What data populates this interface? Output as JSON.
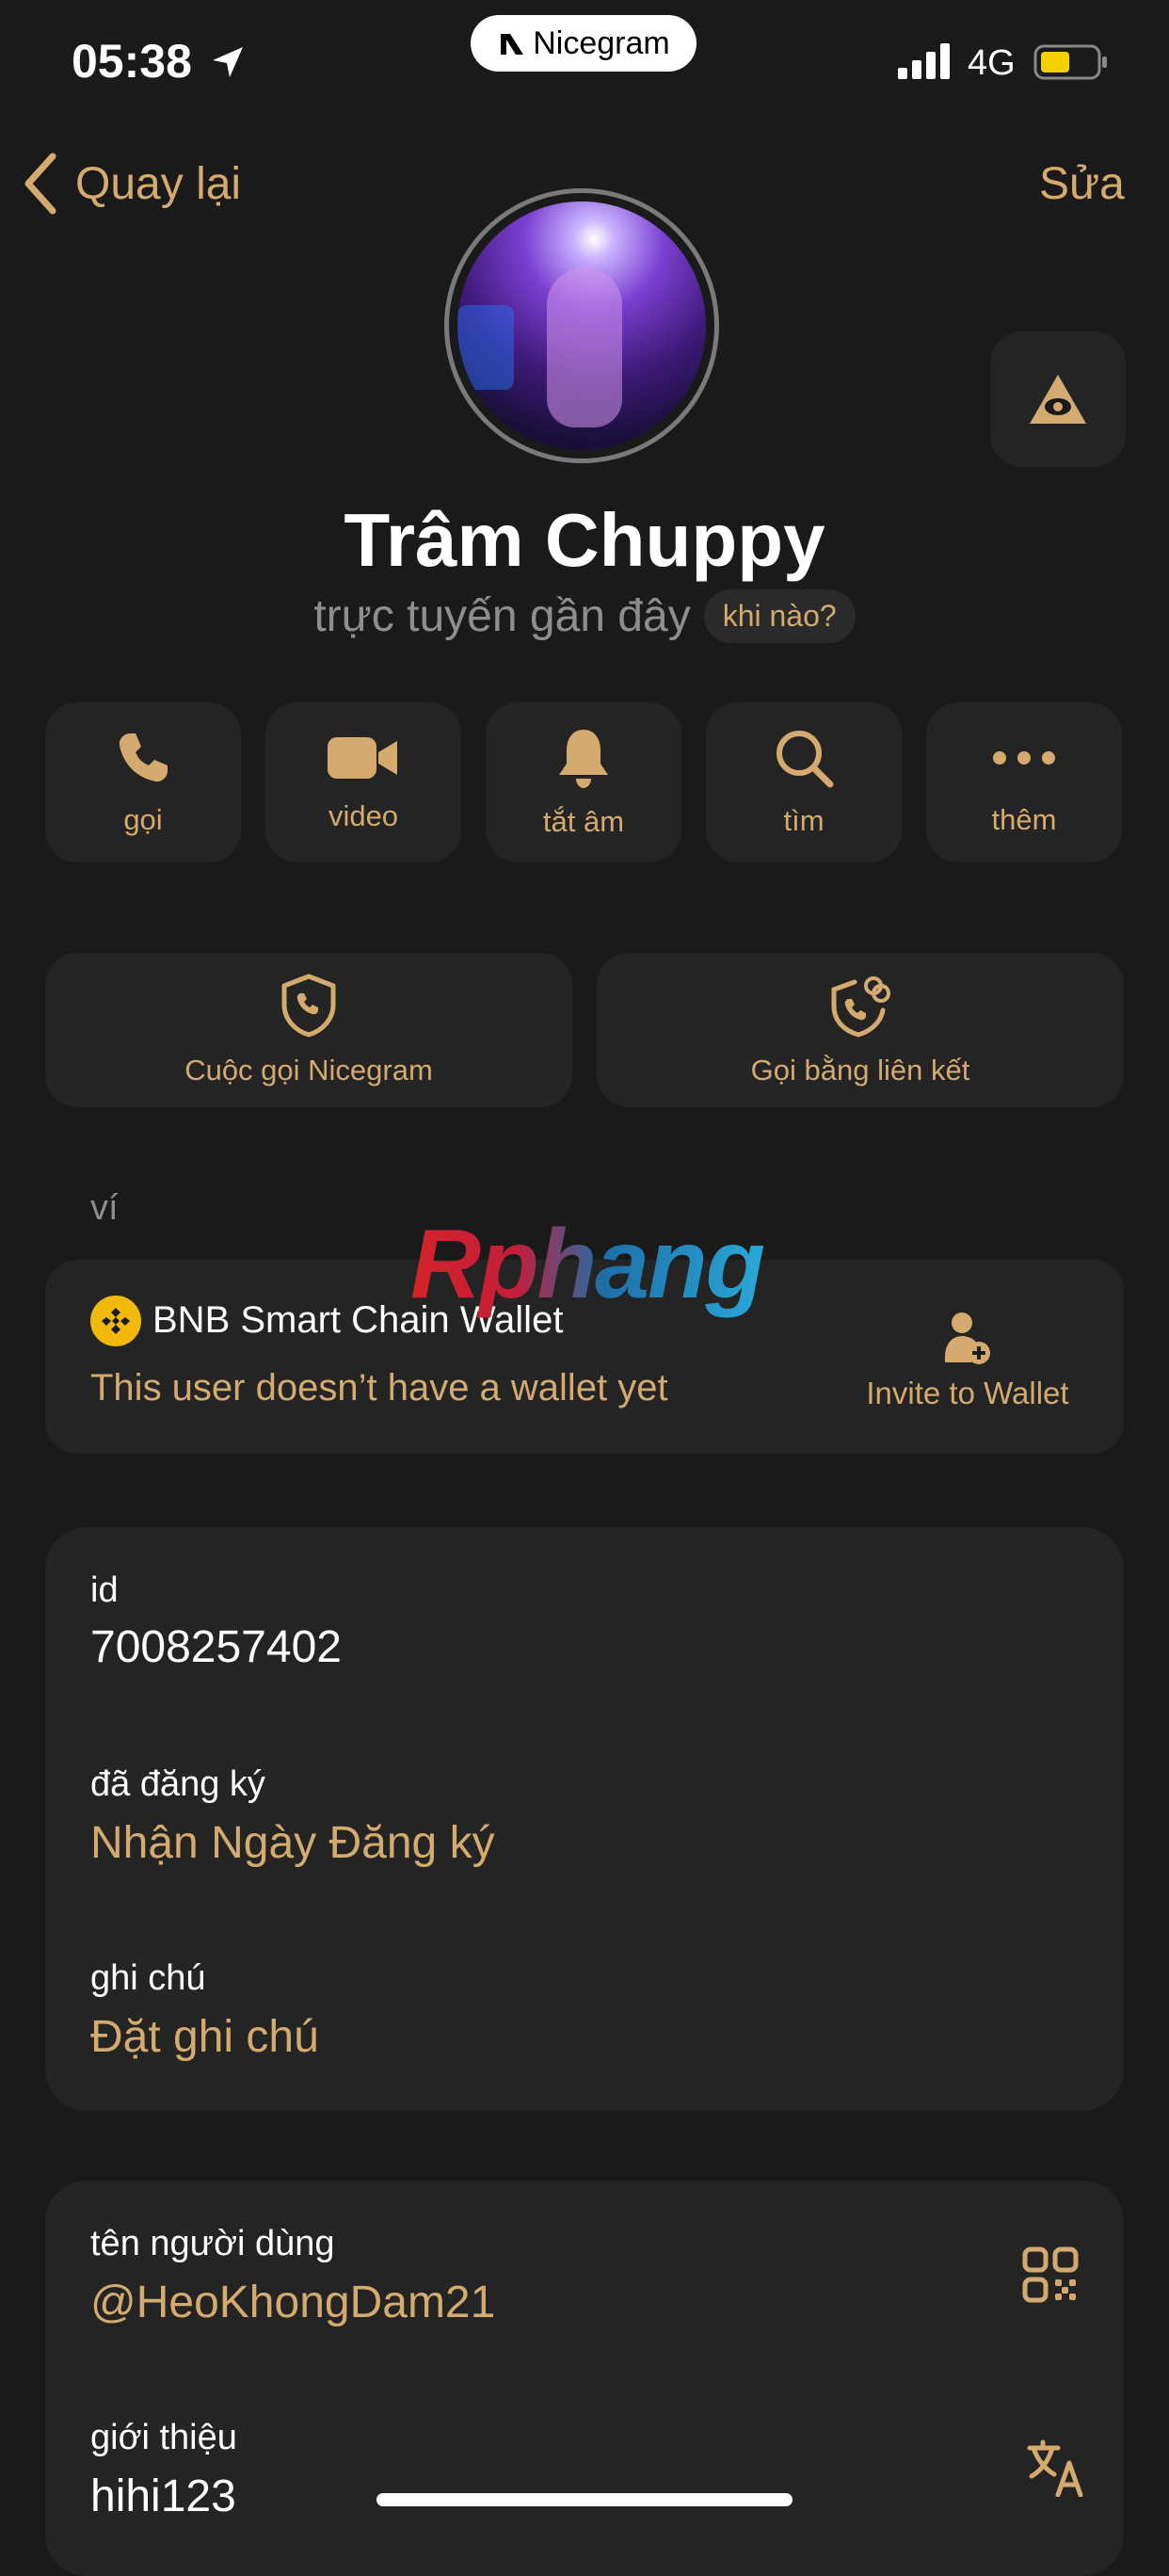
{
  "status_bar": {
    "time": "05:38",
    "carrier_pill": "Nicegram",
    "network": "4G"
  },
  "nav": {
    "back_label": "Quay lại",
    "edit_label": "Sửa"
  },
  "profile": {
    "name": "Trâm Chuppy",
    "status": "trực tuyến gần đây",
    "status_hint": "khi nào?"
  },
  "actions": [
    {
      "label": "gọi",
      "icon": "phone-icon"
    },
    {
      "label": "video",
      "icon": "video-camera-icon"
    },
    {
      "label": "tắt âm",
      "icon": "bell-icon"
    },
    {
      "label": "tìm",
      "icon": "search-icon"
    },
    {
      "label": "thêm",
      "icon": "more-dots-icon"
    }
  ],
  "call_options": {
    "nicegram_call": "Cuộc gọi Nicegram",
    "link_call": "Gọi bằng liên kết"
  },
  "wallet": {
    "section_title": "ví",
    "chain_name": "BNB Smart Chain Wallet",
    "message": "This user doesn’t have a wallet yet",
    "invite_label": "Invite to Wallet"
  },
  "watermark": "Rphang",
  "info": {
    "id_label": "id",
    "id_value": "7008257402",
    "registered_label": "đã đăng ký",
    "registered_value": "Nhận Ngày Đăng ký",
    "note_label": "ghi chú",
    "note_value": "Đặt ghi chú"
  },
  "user": {
    "username_label": "tên người dùng",
    "username_value": "@HeoKhongDam21",
    "bio_label": "giới thiệu",
    "bio_value": "hihi123"
  },
  "colors": {
    "accent": "#d4aa6e",
    "background": "#1a1a1a",
    "card": "#242424"
  }
}
